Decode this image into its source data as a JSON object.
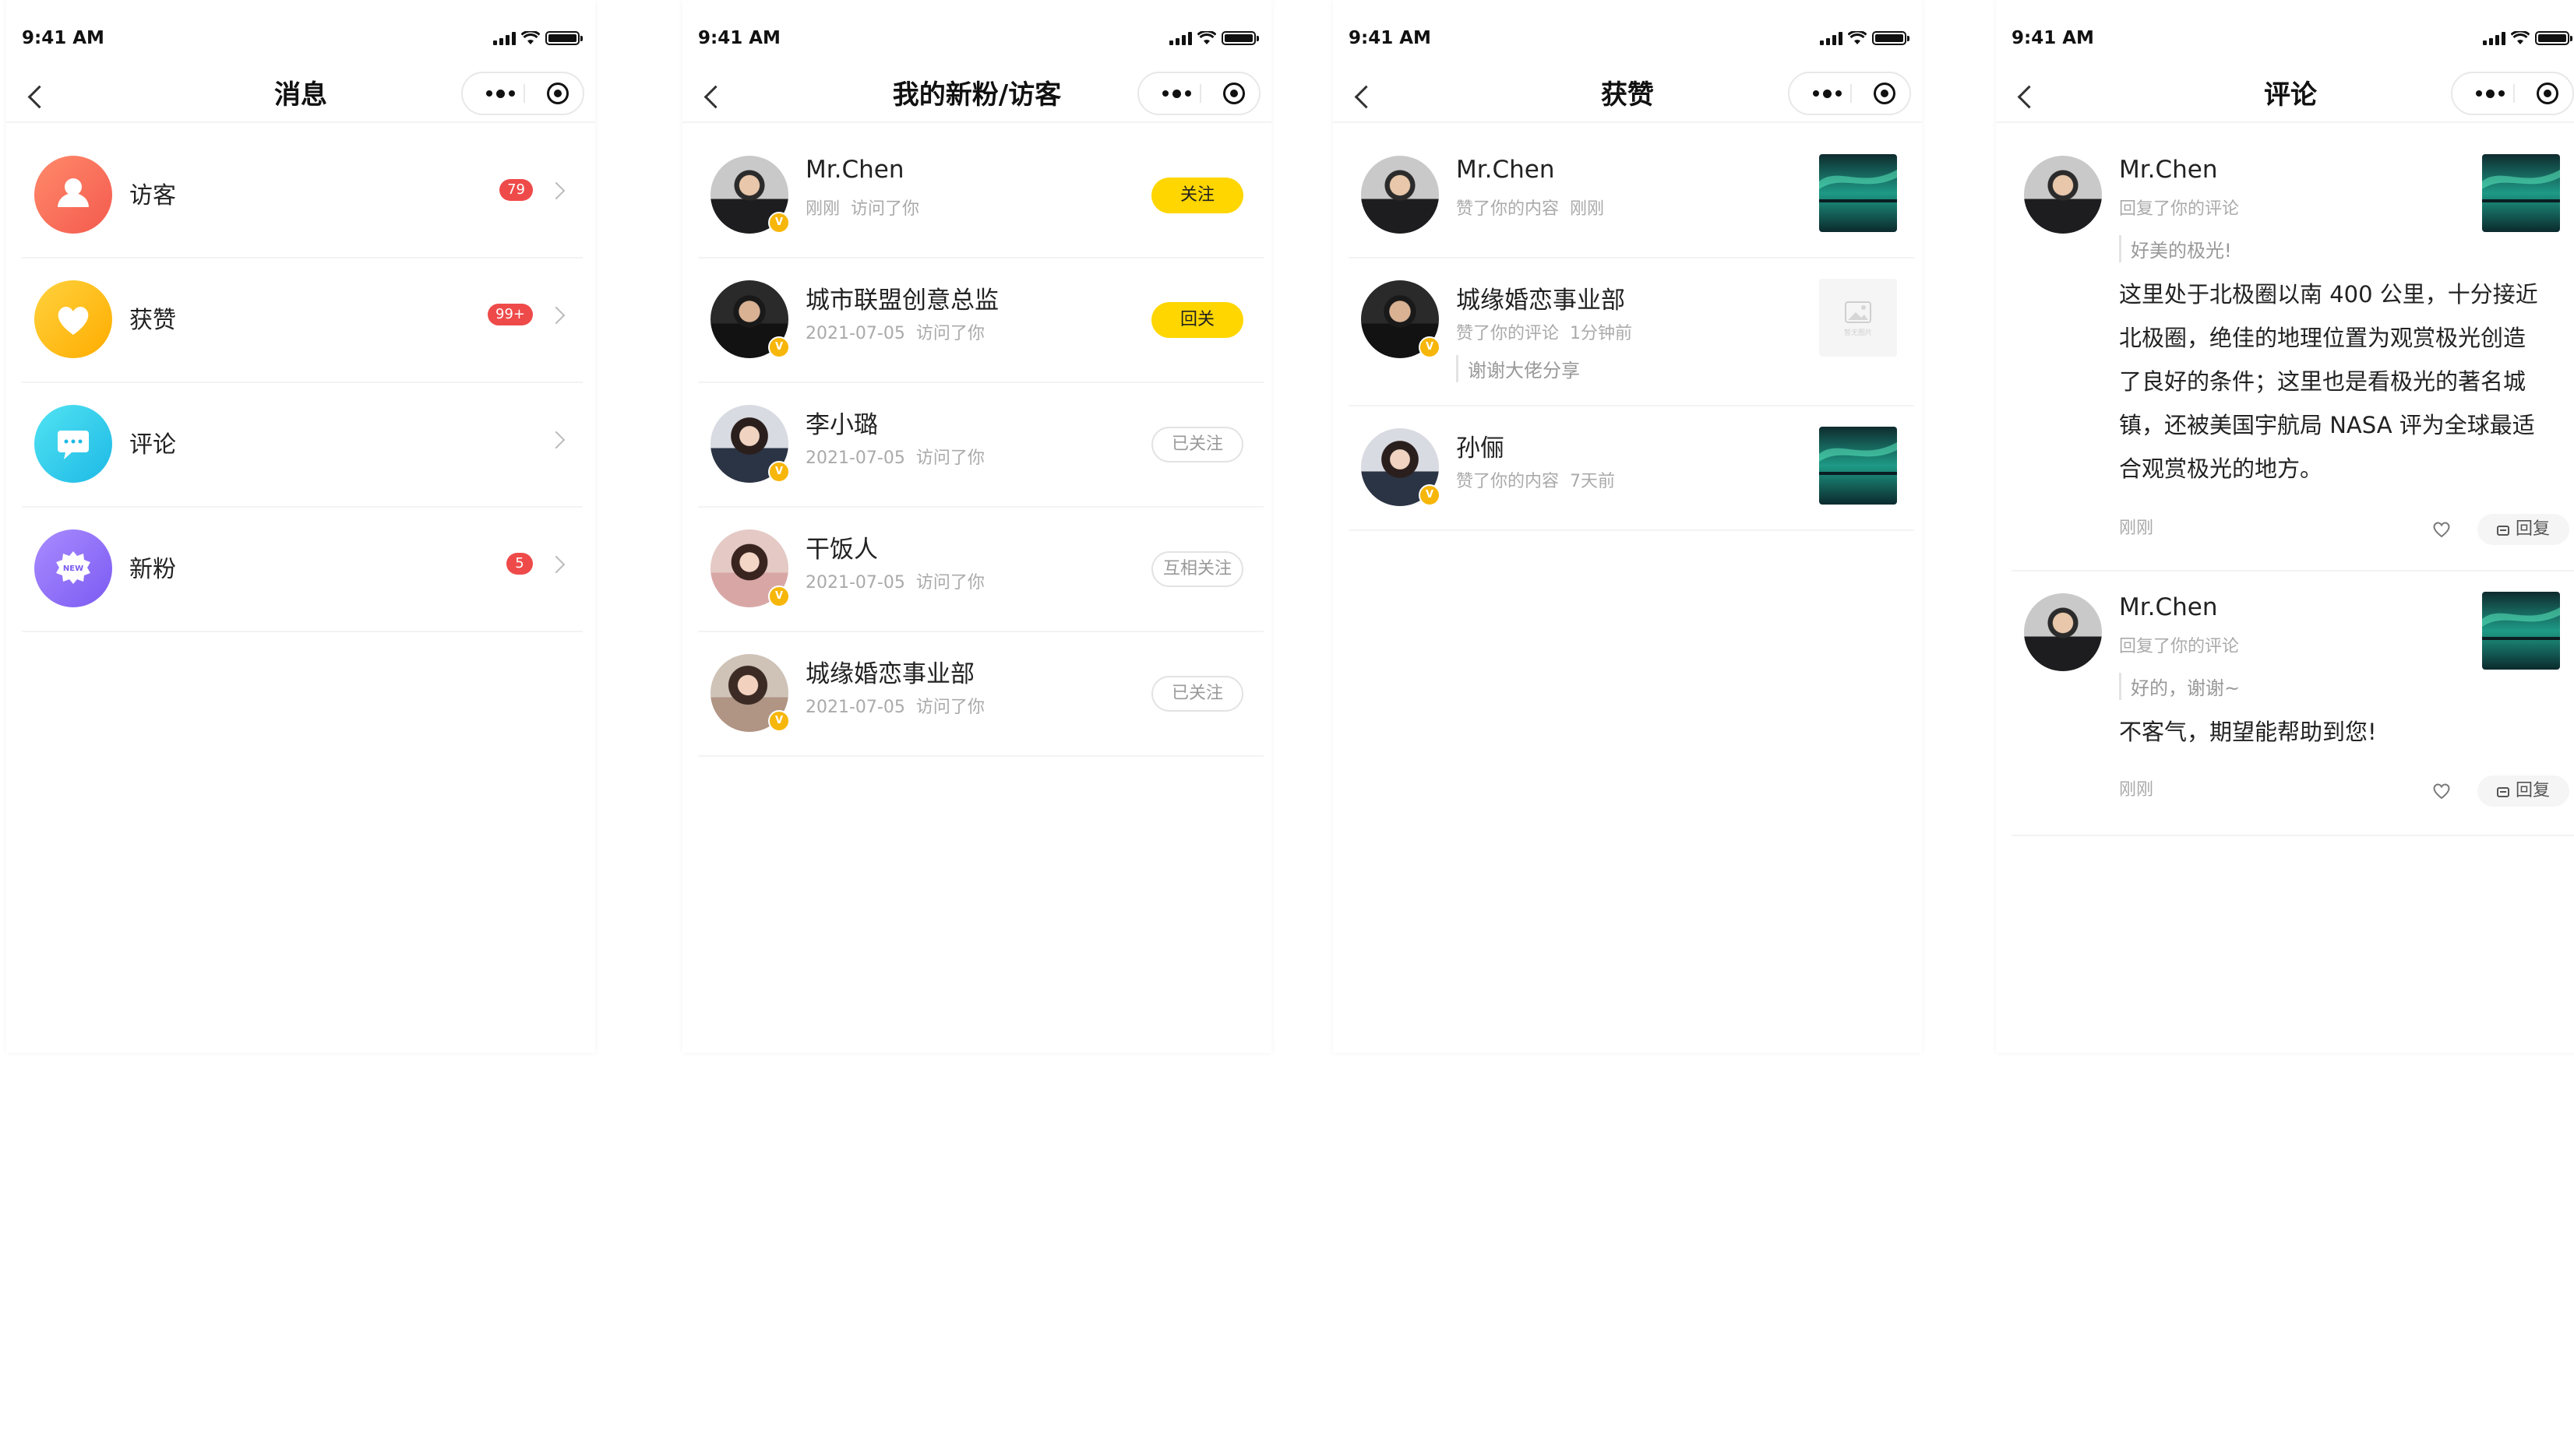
{
  "status_time": "9:41 AM",
  "screens": {
    "messages": {
      "title": "消息",
      "items": [
        {
          "label": "访客",
          "badge": "79"
        },
        {
          "label": "获赞",
          "badge": "99+"
        },
        {
          "label": "评论",
          "badge": ""
        },
        {
          "label": "新粉",
          "badge": "5"
        }
      ],
      "new_icon_text": "NEW"
    },
    "fans": {
      "title": "我的新粉/访客",
      "rows": [
        {
          "name": "Mr.Chen",
          "date": "刚刚",
          "action": "访问了你",
          "button": "关注",
          "verified": true
        },
        {
          "name": "城市联盟创意总监",
          "date": "2021-07-05",
          "action": "访问了你",
          "button": "回关",
          "verified": true
        },
        {
          "name": "李小璐",
          "date": "2021-07-05",
          "action": "访问了你",
          "button": "已关注",
          "verified": true
        },
        {
          "name": "干饭人",
          "date": "2021-07-05",
          "action": "访问了你",
          "button": "互相关注",
          "verified": true
        },
        {
          "name": "城缘婚恋事业部",
          "date": "2021-07-05",
          "action": "访问了你",
          "button": "已关注",
          "verified": true
        }
      ]
    },
    "likes": {
      "title": "获赞",
      "rows": [
        {
          "name": "Mr.Chen",
          "action": "赞了你的内容",
          "time": "刚刚",
          "quote": ""
        },
        {
          "name": "城缘婚恋事业部",
          "action": "赞了你的评论",
          "time": "1分钟前",
          "quote": "谢谢大佬分享",
          "thumb_empty_text": "暂无图片"
        },
        {
          "name": "孙俪",
          "action": "赞了你的内容",
          "time": "7天前",
          "quote": ""
        }
      ]
    },
    "comments": {
      "title": "评论",
      "items": [
        {
          "name": "Mr.Chen",
          "action": "回复了你的评论",
          "quote": "好美的极光!",
          "body_lines": [
            "这里处于北极圈以南 400 公里，十分接近",
            "北极圈，绝佳的地理位置为观赏极光创造",
            "了良好的条件；这里也是看极光的著名城",
            "镇，还被美国宇航局 NASA 评为全球最适",
            "合观赏极光的地方。"
          ],
          "time": "刚刚",
          "reply": "回复"
        },
        {
          "name": "Mr.Chen",
          "action": "回复了你的评论",
          "quote": "好的，谢谢~",
          "body_lines": [
            "不客气，期望能帮助到您!"
          ],
          "time": "刚刚",
          "reply": "回复"
        }
      ]
    }
  },
  "icons": {
    "visitor": "person-icon",
    "likes": "heart-icon",
    "comments": "chat-bubble-icon",
    "new_fans": "new-badge-icon"
  },
  "colors": {
    "accent_yellow": "#ffd600",
    "badge_red": "#ef4a4a",
    "verified": "#f7b60a"
  }
}
